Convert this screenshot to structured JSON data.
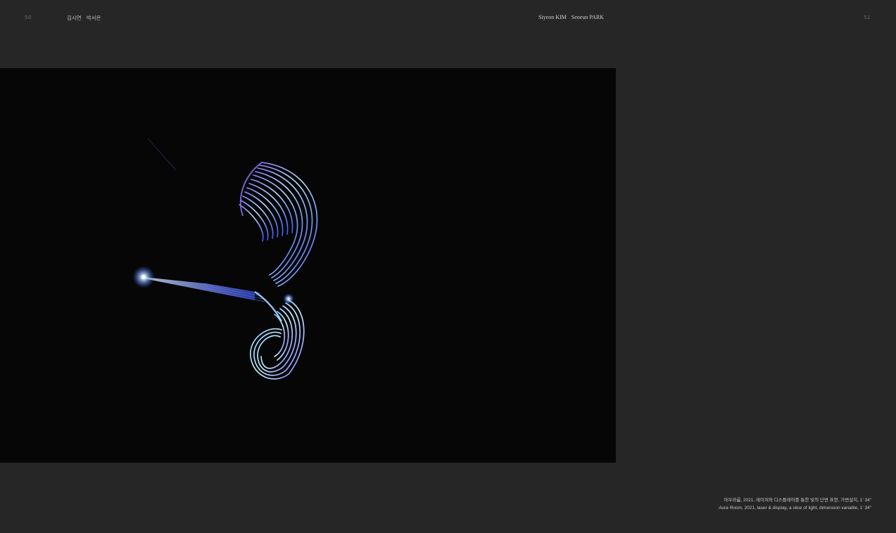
{
  "header": {
    "left_page_number": "50",
    "right_page_number": "51",
    "authors_korean": [
      "김시연",
      "박서은"
    ],
    "authors_english": [
      "Siyeon KIM",
      "Seoeun PARK"
    ]
  },
  "caption": {
    "korean_line": "아우라룸, 2021, 레이저와 디스플레이를 통한 빛의 단면 표현, 가변설치, 1' 34\"",
    "english_title": "Aura Room",
    "english_rest": ", 2021, laser & display, a slice of light, dimension variable, 1' 34\""
  },
  "colors": {
    "background": "#272627",
    "image_background": "#060607",
    "light_blue": "#9fd6ff",
    "light_violet": "#8a7dff"
  }
}
